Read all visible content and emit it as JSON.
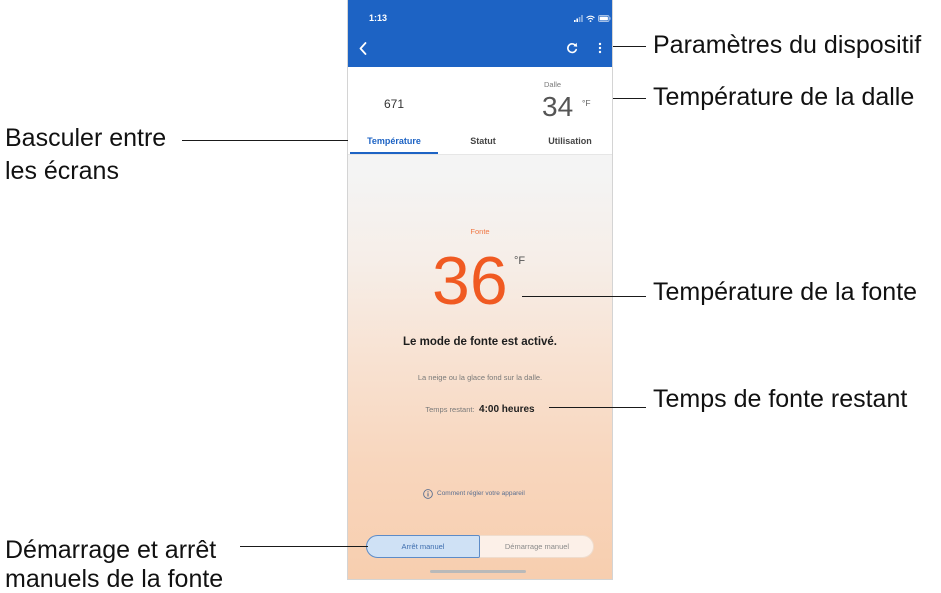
{
  "status_bar": {
    "time": "1:13",
    "icons": [
      "signal-icon",
      "wifi-icon",
      "battery-icon"
    ]
  },
  "nav": {
    "back_icon": "chevron-left-icon",
    "refresh_icon": "refresh-icon",
    "settings_icon": "more-vertical-icon"
  },
  "summary": {
    "device_name": "671",
    "slab_label": "Dalle",
    "slab_temperature": "34",
    "slab_unit": "°F"
  },
  "tabs": [
    {
      "label": "Température",
      "active": true
    },
    {
      "label": "Statut",
      "active": false
    },
    {
      "label": "Utilisation",
      "active": false
    }
  ],
  "melt": {
    "label": "Fonte",
    "temperature": "36",
    "unit": "°F",
    "status_title": "Le mode de fonte est activé.",
    "status_description": "La neige ou la glace fond sur la dalle.",
    "remaining_label": "Temps restant:",
    "remaining_value": "4:00 heures"
  },
  "help": {
    "icon": "info-icon",
    "link": "Comment régler votre appareil"
  },
  "manual_controls": {
    "stop_label": "Arrêt manuel",
    "start_label": "Démarrage manuel",
    "stop_selected": true
  },
  "annotations": {
    "device_settings": "Paramètres du dispositif",
    "slab_temperature": "Température de la dalle",
    "switch_screens": [
      "Basculer entre",
      "les écrans"
    ],
    "melt_temperature": "Température de la fonte",
    "remaining_time": "Temps de fonte restant",
    "manual_start_stop": [
      "Démarrage et arrêt",
      "manuels de la fonte"
    ]
  },
  "colors": {
    "header_blue": "#1d63c4",
    "active_tab": "#1d63c4",
    "melt_orange": "#f05a22",
    "label_orange": "#f07845",
    "selected_segment": "#cfe1f5"
  }
}
